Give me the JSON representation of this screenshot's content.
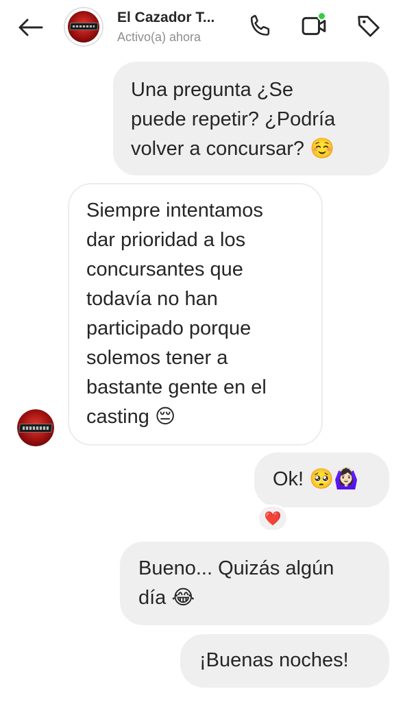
{
  "header": {
    "title": "El Cazador T...",
    "status": "Activo(a) ahora",
    "icons": [
      "back-arrow-icon",
      "phone-icon",
      "video-call-icon",
      "tag-icon"
    ],
    "video_active_color": "#2fcf44"
  },
  "messages": [
    {
      "direction": "outgoing",
      "lines": [
        "Una pregunta ¿Se",
        "puede repetir? ¿Podría",
        "volver a concursar? ☺️"
      ]
    },
    {
      "direction": "incoming",
      "lines": [
        "Siempre intentamos",
        "dar prioridad a los",
        "concursantes que",
        "todavía no han",
        "participado porque",
        "solemos tener a",
        "bastante gente en el",
        "casting 😔"
      ]
    },
    {
      "direction": "outgoing",
      "lines": [
        "Ok! 🥺🙆🏻‍♀️"
      ],
      "reaction": "❤️"
    },
    {
      "direction": "outgoing",
      "lines": [
        "Bueno... Quizás algún",
        "día 😂"
      ]
    },
    {
      "direction": "outgoing",
      "lines": [
        "¡Buenas noches!"
      ]
    }
  ],
  "colors": {
    "outgoing_bubble": "#efefef",
    "incoming_border": "#ececec",
    "reaction_heart": "#ed1a2f",
    "muted_text": "#8e8e8e"
  }
}
